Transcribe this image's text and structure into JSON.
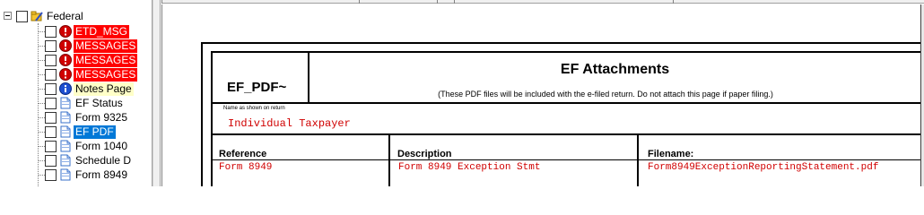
{
  "tree": {
    "root_label": "Federal",
    "items": [
      {
        "label": "ETD_MSG",
        "icon": "error-icon",
        "style": "red"
      },
      {
        "label": "MESSAGES",
        "icon": "error-icon",
        "style": "red"
      },
      {
        "label": "MESSAGES",
        "icon": "error-icon",
        "style": "red"
      },
      {
        "label": "MESSAGES",
        "icon": "error-icon",
        "style": "red"
      },
      {
        "label": "Notes Page",
        "icon": "info-icon",
        "style": "yellow"
      },
      {
        "label": "EF Status",
        "icon": "document-icon",
        "style": "normal"
      },
      {
        "label": "Form 9325",
        "icon": "document-icon",
        "style": "normal"
      },
      {
        "label": "EF PDF",
        "icon": "document-icon",
        "style": "selected"
      },
      {
        "label": "Form 1040",
        "icon": "document-icon",
        "style": "normal"
      },
      {
        "label": "Schedule D",
        "icon": "document-icon",
        "style": "normal"
      },
      {
        "label": "Form 8949",
        "icon": "document-icon",
        "style": "normal"
      }
    ]
  },
  "form": {
    "id": "EF_PDF~",
    "title": "EF Attachments",
    "subtitle": "(These PDF files will be included with the e-filed return. Do not attach this page if paper filing.)",
    "name_caption": "Name as shown on return",
    "taxpayer_name": "Individual Taxpayer",
    "columns": {
      "reference": "Reference",
      "description": "Description",
      "filename": "Filename:"
    },
    "rows": [
      {
        "reference": "Form 8949",
        "description": "Form 8949 Exception Stmt",
        "filename": "Form8949ExceptionReportingStatement.pdf"
      }
    ]
  },
  "colors": {
    "error_bg": "#ff0000",
    "notes_bg": "#ffffc8",
    "selected_bg": "#0078d7",
    "value_text": "#d00000"
  }
}
